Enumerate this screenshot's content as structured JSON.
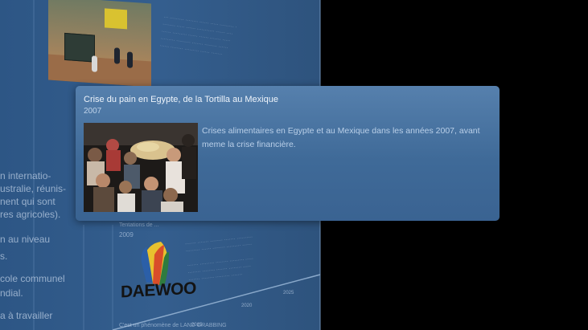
{
  "popup": {
    "title": "Crise du pain en Egypte, de la Tortilla au Mexique",
    "year": "2007",
    "description": "Crises alimentaires en Egypte et au Mexique dans les années 2007, avant meme la crise financière.",
    "photo_icon": "crowd-bread-photo"
  },
  "background_panel": {
    "left_fragments": [
      "n internatio-",
      "ustralie, réunis-",
      "nent qui sont",
      "res agricoles).",
      "n au niveau",
      "s.",
      "cole communel",
      "ndial.",
      "a à travailler"
    ],
    "second_entry": {
      "label": "Tentations de ...",
      "year": "2009",
      "footer": "C'est un phénomène de LAND GRABBING"
    },
    "timeline_years": [
      "2015",
      "2020",
      "2025"
    ],
    "logo_text": "DAEWOO"
  },
  "colors": {
    "popup_top": "#5680ad",
    "popup_bottom": "#3a6392",
    "panel": "#3b5f8a",
    "background": "#000000"
  }
}
